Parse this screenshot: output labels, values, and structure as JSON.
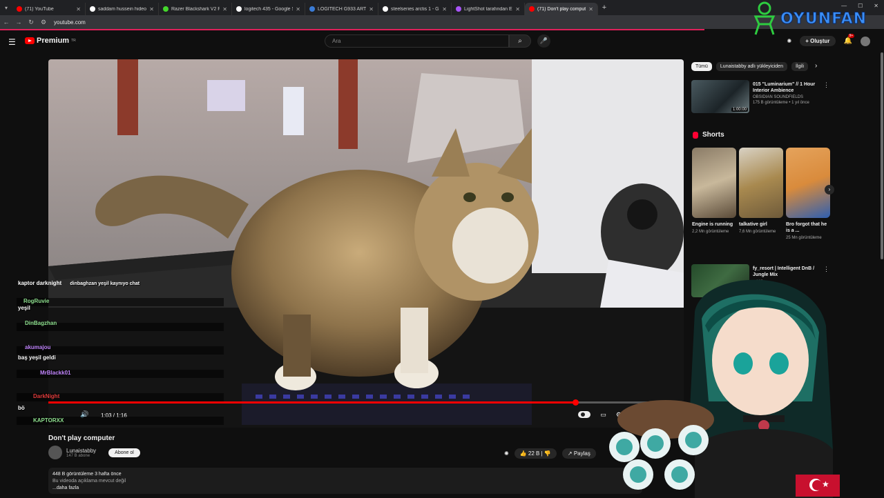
{
  "browser": {
    "tabs": [
      {
        "title": "(71) YouTube",
        "color": "#ff0000"
      },
      {
        "title": "saddam hussein hideout - Goo",
        "color": "#ffffff"
      },
      {
        "title": "Razer Blackshark V2 Pro Kablos",
        "color": "#44d62c"
      },
      {
        "title": "logitech 435 - Google Search",
        "color": "#ffffff"
      },
      {
        "title": "LOGITECH G933 ARTEMIS RGB",
        "color": "#3a7bd5"
      },
      {
        "title": "steelseries arctis 1 - Google Se",
        "color": "#ffffff"
      },
      {
        "title": "LightShot tarafından Ekran Gör",
        "color": "#a855f7"
      },
      {
        "title": "(71) Don't play computer - You",
        "color": "#ff0000"
      }
    ],
    "url": "youtube.com",
    "new_tab": "+"
  },
  "youtube": {
    "logo_text": "Premium",
    "logo_region": "TR",
    "search_placeholder": "Ara",
    "create_label": "Oluştur",
    "notif_count": "9+"
  },
  "brand": {
    "name": "OYUNFAN"
  },
  "player": {
    "time": "1:03 / 1:16",
    "progress": 0.8289
  },
  "video": {
    "title": "Don't play computer",
    "channel": "Lunaistabby",
    "subs": "147 B abone",
    "subscribe": "Abone ol",
    "likes": "22 B",
    "share": "Paylaş",
    "views_line": "448 B görüntüleme  3 hafta önce",
    "desc_line": "Bu videoda açıklama mevcut değil",
    "more": "...daha fazla"
  },
  "sidebar": {
    "chips": [
      "Tümü",
      "Lunaistabby adlı yükleyiciden",
      "İlgili"
    ],
    "rec1": {
      "title": "015 \"Luminarium\" // 1 Hour Interior Ambience",
      "channel": "OBSIDIAN SOUNDFIELDS",
      "meta": "175 B görüntüleme • 1 yıl önce",
      "duration": "1:00:00"
    },
    "shorts_title": "Shorts",
    "shorts": [
      {
        "title": "Engine is running",
        "views": "2,2 Mn görüntüleme"
      },
      {
        "title": "talkative girl",
        "views": "7,6 Mn görüntüleme"
      },
      {
        "title": "Bro forgot that he is a ...",
        "views": "25 Mn görüntüleme"
      }
    ],
    "rec2": {
      "title": "fy_resort | Intelligent DnB / Jungle Mix",
      "meta": "...nce"
    }
  },
  "chat": [
    {
      "name": "kaptor darknight",
      "color": "#ffffff",
      "msg": "dinbaghzan yeşil kaynıyo chat"
    },
    {
      "name": "RogRuvie",
      "color": "#8ee08e",
      "msg": "yeşil"
    },
    {
      "name": "DinBagzhan",
      "color": "#8ee08e",
      "msg": ""
    },
    {
      "name": "akumajou",
      "color": "#c084fc",
      "msg": "baş yeşil geldi"
    },
    {
      "name": "MrBlackk01",
      "color": "#c084fc",
      "msg": ""
    },
    {
      "name": "DarkNight",
      "color": "#e03a3a",
      "msg": "bö"
    },
    {
      "name": "KAPTORXX",
      "color": "#8ee08e",
      "msg": ""
    }
  ]
}
